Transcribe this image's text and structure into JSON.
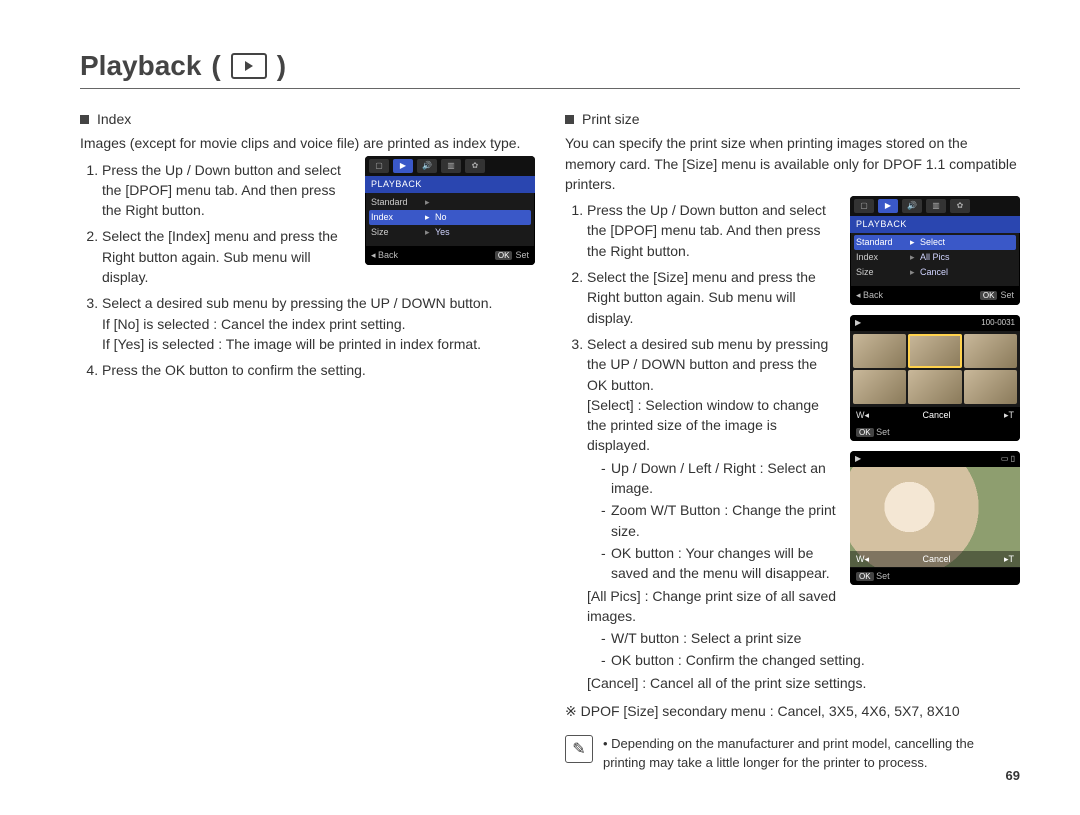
{
  "page": {
    "title": "Playback",
    "number": "69"
  },
  "left": {
    "heading": "Index",
    "intro": "Images (except for movie clips and voice file) are printed as index type.",
    "steps": [
      "Press the Up / Down button and select the [DPOF] menu tab. And then press the Right button.",
      "Select the [Index] menu and press the Right button again. Sub menu will display.",
      "Select a desired sub menu by pressing the UP / DOWN button.",
      "Press the OK button to confirm the setting."
    ],
    "step3_no": "If [No] is selected   : Cancel the index print setting.",
    "step3_yes": "If [Yes] is selected : The image will be printed in index format.",
    "lcd": {
      "header": "PLAYBACK",
      "rows": [
        {
          "l": "Standard",
          "r": ""
        },
        {
          "l": "Index",
          "r": "No",
          "sel": true
        },
        {
          "l": "Size",
          "r": "Yes"
        }
      ],
      "back": "Back",
      "set": "Set",
      "ok": "OK"
    }
  },
  "right": {
    "heading": "Print size",
    "intro": "You can specify the print size when printing images stored on the memory card. The [Size] menu is available only for DPOF 1.1 compatible printers.",
    "steps": [
      "Press the Up / Down button and select the [DPOF] menu tab. And then press the Right button.",
      "Select the [Size] menu and press the Right button again. Sub menu will display.",
      "Select a desired sub menu by pressing the UP / DOWN button and press the OK button."
    ],
    "opt_select_label": "[Select] :",
    "opt_select_desc": "Selection window to change the printed size of the image is displayed.",
    "select_sub": [
      "Up / Down / Left / Right : Select an image.",
      "Zoom W/T Button : Change the print size.",
      "OK button : Your changes will be saved and the menu will disappear."
    ],
    "opt_all_label": "[All Pics] :",
    "opt_all_desc": "Change print size of all saved images.",
    "all_sub": [
      "W/T button : Select a print size",
      "OK button : Confirm the changed setting."
    ],
    "opt_cancel_label": "[Cancel] :",
    "opt_cancel_desc": "Cancel all of the print size settings.",
    "secondary": "DPOF [Size] secondary menu : Cancel, 3X5, 4X6, 5X7, 8X10",
    "note": "Depending on the manufacturer and print model, cancelling the printing may take a little longer for the printer to process.",
    "lcd": {
      "header": "PLAYBACK",
      "rows": [
        {
          "l": "Standard",
          "r": "Select",
          "sel": true
        },
        {
          "l": "Index",
          "r": "All Pics"
        },
        {
          "l": "Size",
          "r": "Cancel"
        }
      ],
      "back": "Back",
      "set": "Set",
      "ok": "OK"
    },
    "thumb": {
      "counter": "100-0031",
      "w": "W",
      "t": "T",
      "mid": "Cancel",
      "set": "Set",
      "ok": "OK"
    },
    "photo": {
      "w": "W",
      "t": "T",
      "mid": "Cancel",
      "set": "Set",
      "ok": "OK"
    }
  }
}
